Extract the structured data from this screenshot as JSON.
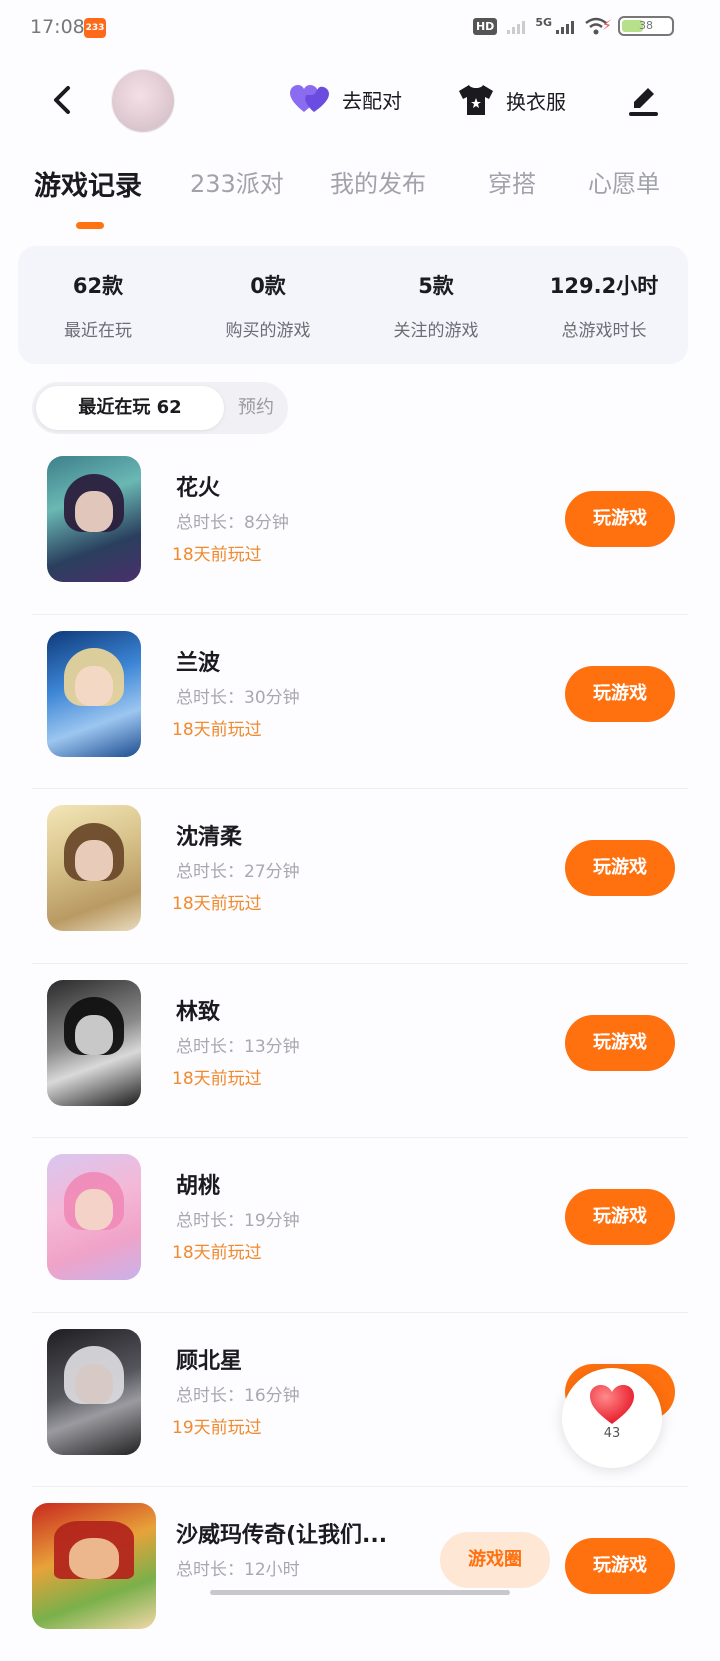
{
  "status_bar": {
    "time": "17:08",
    "app_badge": "233",
    "battery": "38",
    "network": "5G",
    "hd": "HD"
  },
  "header": {
    "match_label": "去配对",
    "outfit_label": "换衣服"
  },
  "tabs": [
    "游戏记录",
    "233派对",
    "我的发布",
    "穿搭",
    "心愿单"
  ],
  "active_tab": "游戏记录",
  "stats": [
    {
      "value": "62款",
      "label": "最近在玩"
    },
    {
      "value": "0款",
      "label": "购买的游戏"
    },
    {
      "value": "5款",
      "label": "关注的游戏"
    },
    {
      "value": "129.2小时",
      "label": "总游戏时长"
    }
  ],
  "segment": {
    "active": "最近在玩 62",
    "inactive": "预约"
  },
  "games": [
    {
      "title": "花火",
      "duration": "总时长：8分钟",
      "last_played": "18天前玩过",
      "button": "玩游戏"
    },
    {
      "title": "兰波",
      "duration": "总时长：30分钟",
      "last_played": "18天前玩过",
      "button": "玩游戏"
    },
    {
      "title": "沈清柔",
      "duration": "总时长：27分钟",
      "last_played": "18天前玩过",
      "button": "玩游戏"
    },
    {
      "title": "林致",
      "duration": "总时长：13分钟",
      "last_played": "18天前玩过",
      "button": "玩游戏"
    },
    {
      "title": "胡桃",
      "duration": "总时长：19分钟",
      "last_played": "18天前玩过",
      "button": "玩游戏"
    },
    {
      "title": "顾北星",
      "duration": "总时长：16分钟",
      "last_played": "19天前玩过",
      "button": "玩游戏"
    },
    {
      "title": "沙威玛传奇(让我们...",
      "duration": "总时长：12小时",
      "last_played": "",
      "button": "玩游戏"
    }
  ],
  "like_fab": {
    "count": "43"
  },
  "circle_chip": "游戏圈",
  "colors": {
    "accent": "#ff700f",
    "last_played": "#f08a2e",
    "stats_bg": "#f3f5fb"
  }
}
